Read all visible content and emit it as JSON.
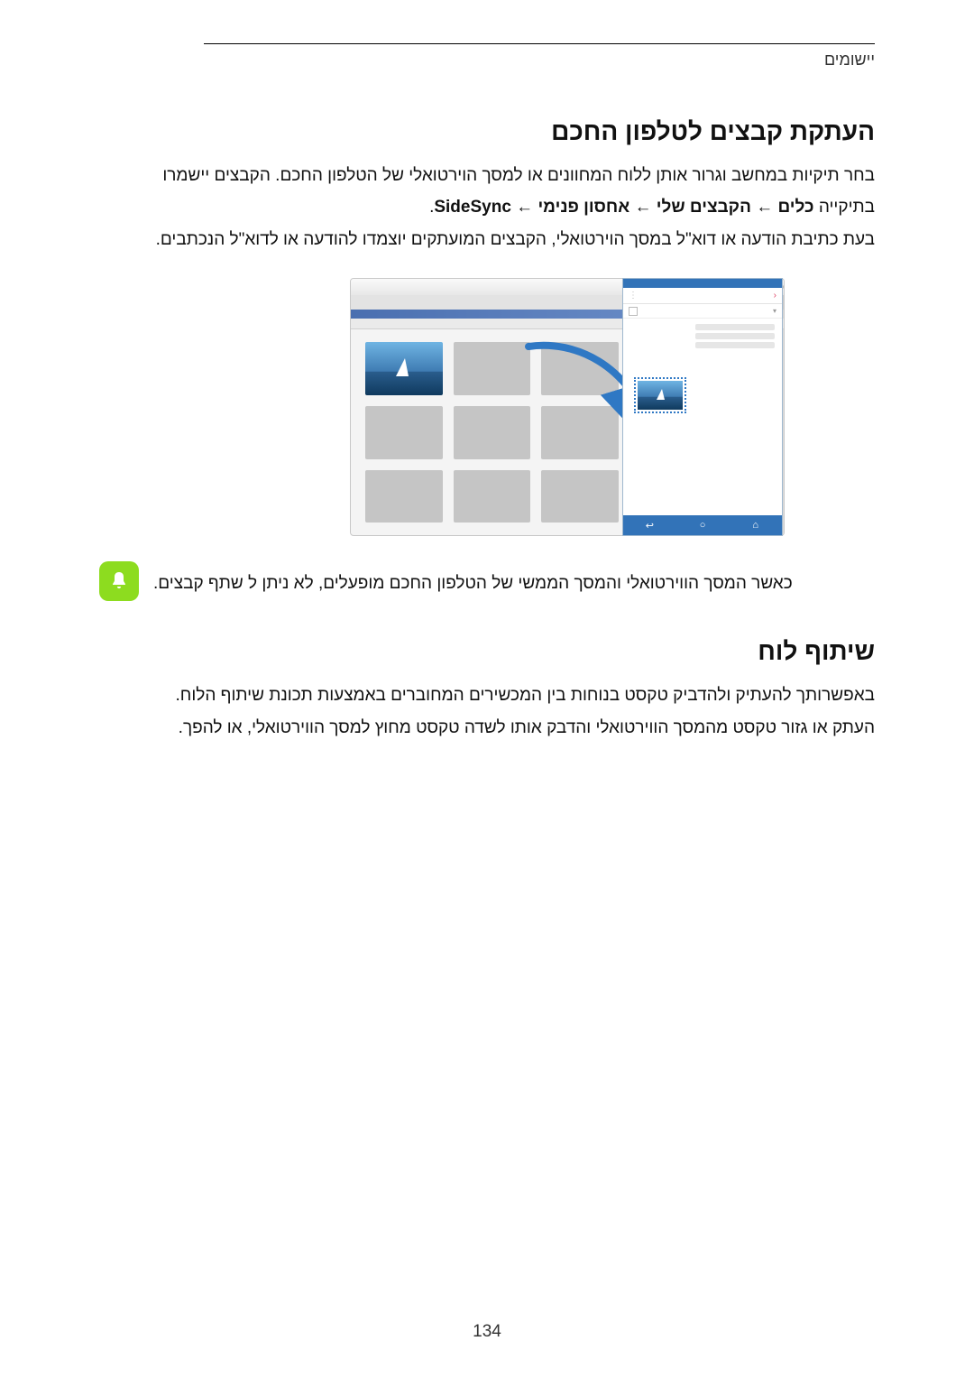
{
  "header": {
    "section_label": "יישומים"
  },
  "section1": {
    "title": "העתקת קבצים לטלפון החכם",
    "p1": "בחר תיקיות במחשב וגרור אותן ללוח המחוונים או למסך הוירטואלי של הטלפון החכם. הקבצים יישמרו",
    "p2_prefix": "בתיקייה ",
    "p2_bold": "כלים ← הקבצים שלי ← אחסון פנימי ← SideSync",
    "p2_suffix": ".",
    "p3": "בעת כתיבת הודעה או דוא\"ל במסך הוירטואלי, הקבצים המועתקים יוצמדו להודעה או לדוא\"ל הנכתבים."
  },
  "figure": {
    "phone_back_glyph": "‹",
    "phone_menu_glyph": "⋮",
    "phone_caret_glyph": "▾",
    "nav_recent": "⌂",
    "nav_home": "○",
    "nav_back": "↩"
  },
  "note": {
    "text": "כאשר המסך הווירטואלי והמסך הממשי של הטלפון החכם מופעלים, לא ניתן ל שתף קבצים."
  },
  "section2": {
    "title": "שיתוף לוח",
    "p1": "באפשרותך להעתיק ולהדביק טקסט בנוחות בין המכשירים המחוברים באמצעות תכונת שיתוף הלוח.",
    "p2": "העתק או גזור טקסט מהמסך הווירטואלי והדבק אותו לשדה טקסט מחוץ למסך הווירטואלי, או להפך."
  },
  "page_number": "134"
}
